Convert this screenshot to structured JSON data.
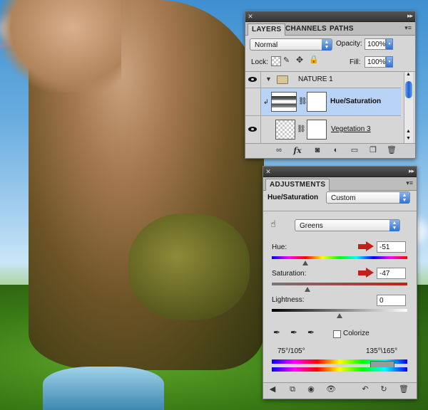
{
  "layers_panel": {
    "tabs": [
      "LAYERS",
      "CHANNELS",
      "PATHS"
    ],
    "blend_mode": "Normal",
    "opacity_label": "Opacity:",
    "opacity_value": "100%",
    "lock_label": "Lock:",
    "fill_label": "Fill:",
    "fill_value": "100%",
    "layers": [
      {
        "name": "NATURE 1",
        "type": "group"
      },
      {
        "name": "Hue/Saturation",
        "type": "adjustment",
        "selected": true
      },
      {
        "name": "Vegetation 3",
        "type": "layer"
      }
    ],
    "footer_icons": [
      "link-icon",
      "fx-icon",
      "mask-icon",
      "adjustment-icon",
      "folder-icon",
      "new-layer-icon",
      "trash-icon"
    ]
  },
  "adjustments_panel": {
    "tab": "ADJUSTMENTS",
    "title": "Hue/Saturation",
    "preset": "Custom",
    "channel": "Greens",
    "hue_label": "Hue:",
    "hue_value": "-51",
    "saturation_label": "Saturation:",
    "saturation_value": "-47",
    "lightness_label": "Lightness:",
    "lightness_value": "0",
    "colorize_label": "Colorize",
    "range_left": "75°/105°",
    "range_right": "135°\\165°",
    "hue_level": -51,
    "saturation_level": -47,
    "lightness_level": 0,
    "footer_icons": [
      "back-arrow-icon",
      "expand-view-icon",
      "clip-icon",
      "visibility-eye-icon",
      "previous-state-icon",
      "reset-icon",
      "delete-icon"
    ]
  },
  "colors": {
    "accent_blue": "#2f6fd6",
    "selection": "#b8d3f5",
    "annotation_red": "#c0201a"
  }
}
